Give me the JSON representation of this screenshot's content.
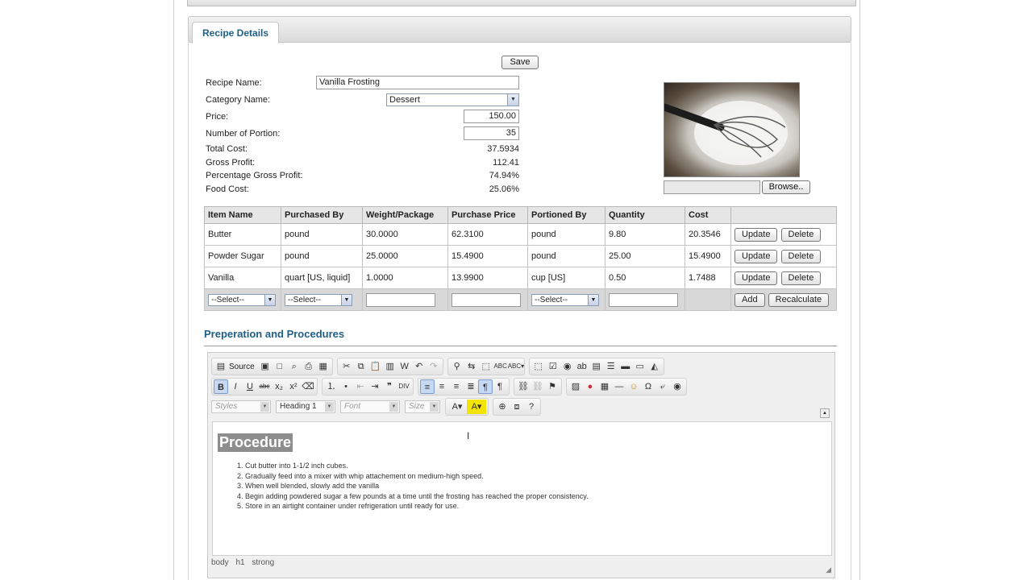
{
  "tab": {
    "label": "Recipe Details"
  },
  "form": {
    "save_label": "Save",
    "recipe_name_label": "Recipe Name:",
    "recipe_name_value": "Vanilla Frosting",
    "category_label": "Category Name:",
    "category_value": "Dessert",
    "price_label": "Price:",
    "price_value": "150.00",
    "portion_label": "Number of Portion:",
    "portion_value": "35",
    "total_cost_label": "Total Cost:",
    "total_cost_value": "37.5934",
    "gross_profit_label": "Gross Profit:",
    "gross_profit_value": "112.41",
    "pct_gross_profit_label": "Percentage Gross Profit:",
    "pct_gross_profit_value": "74.94%",
    "food_cost_label": "Food Cost:",
    "food_cost_value": "25.06%",
    "browse_label": "Browse.."
  },
  "items_table": {
    "headers": [
      "Item Name",
      "Purchased By",
      "Weight/Package",
      "Purchase Price",
      "Portioned By",
      "Quantity",
      "Cost",
      ""
    ],
    "rows": [
      {
        "item": "Butter",
        "purchased_by": "pound",
        "weight": "30.0000",
        "price": "62.3100",
        "portioned_by": "pound",
        "quantity": "9.80",
        "cost": "20.3546"
      },
      {
        "item": "Powder Sugar",
        "purchased_by": "pound",
        "weight": "25.0000",
        "price": "15.4900",
        "portioned_by": "pound",
        "quantity": "25.00",
        "cost": "15.4900"
      },
      {
        "item": "Vanilla",
        "purchased_by": "quart [US, liquid]",
        "weight": "1.0000",
        "price": "13.9900",
        "portioned_by": "cup [US]",
        "quantity": "0.50",
        "cost": "1.7488"
      }
    ],
    "update_label": "Update",
    "delete_label": "Delete",
    "select_placeholder": "--Select--",
    "add_label": "Add",
    "recalculate_label": "Recalculate"
  },
  "procedures": {
    "section_title": "Preperation and Procedures",
    "toolbar": {
      "source_label": "Source",
      "styles_combo": "Styles",
      "format_combo": "Heading 1",
      "font_combo": "Font",
      "size_combo": "Size"
    },
    "heading": "Procedure",
    "steps": [
      "Cut butter into 1-1/2 inch cubes.",
      "Gradually feed into a mixer with whip attachement on medium-high speed.",
      "When well blended, slowly add the vanilla",
      "Begin adding powdered sugar a few pounds at a time until the frosting has reached the proper consistency.",
      "Store in an airtight container under refrigeration until ready for use."
    ],
    "path": [
      "body",
      "h1",
      "strong"
    ]
  },
  "colors": {
    "accent": "#1f5f86",
    "heading_bg": "#8d8d8d"
  }
}
